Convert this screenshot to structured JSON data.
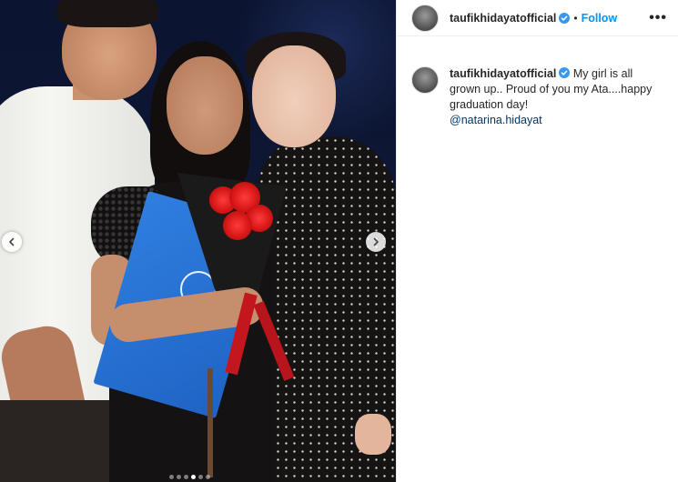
{
  "post": {
    "username": "taufikhidayatofficial",
    "follow_label": "Follow",
    "separator": "•",
    "more_label": "•••",
    "caption": {
      "username": "taufikhidayatofficial",
      "text": "My girl is all grown up.. Proud of you my Ata....happy graduation day!",
      "mention": "@natarina.hidayat"
    }
  },
  "carousel": {
    "dot_count": 6,
    "active_index": 3
  },
  "colors": {
    "follow_blue": "#0095f6",
    "verified_blue": "#3897f0",
    "mention": "#00376b"
  },
  "icons": {
    "prev": "chevron-left-icon",
    "next": "chevron-right-icon",
    "verified": "verified-badge-icon",
    "more": "more-options-icon"
  }
}
